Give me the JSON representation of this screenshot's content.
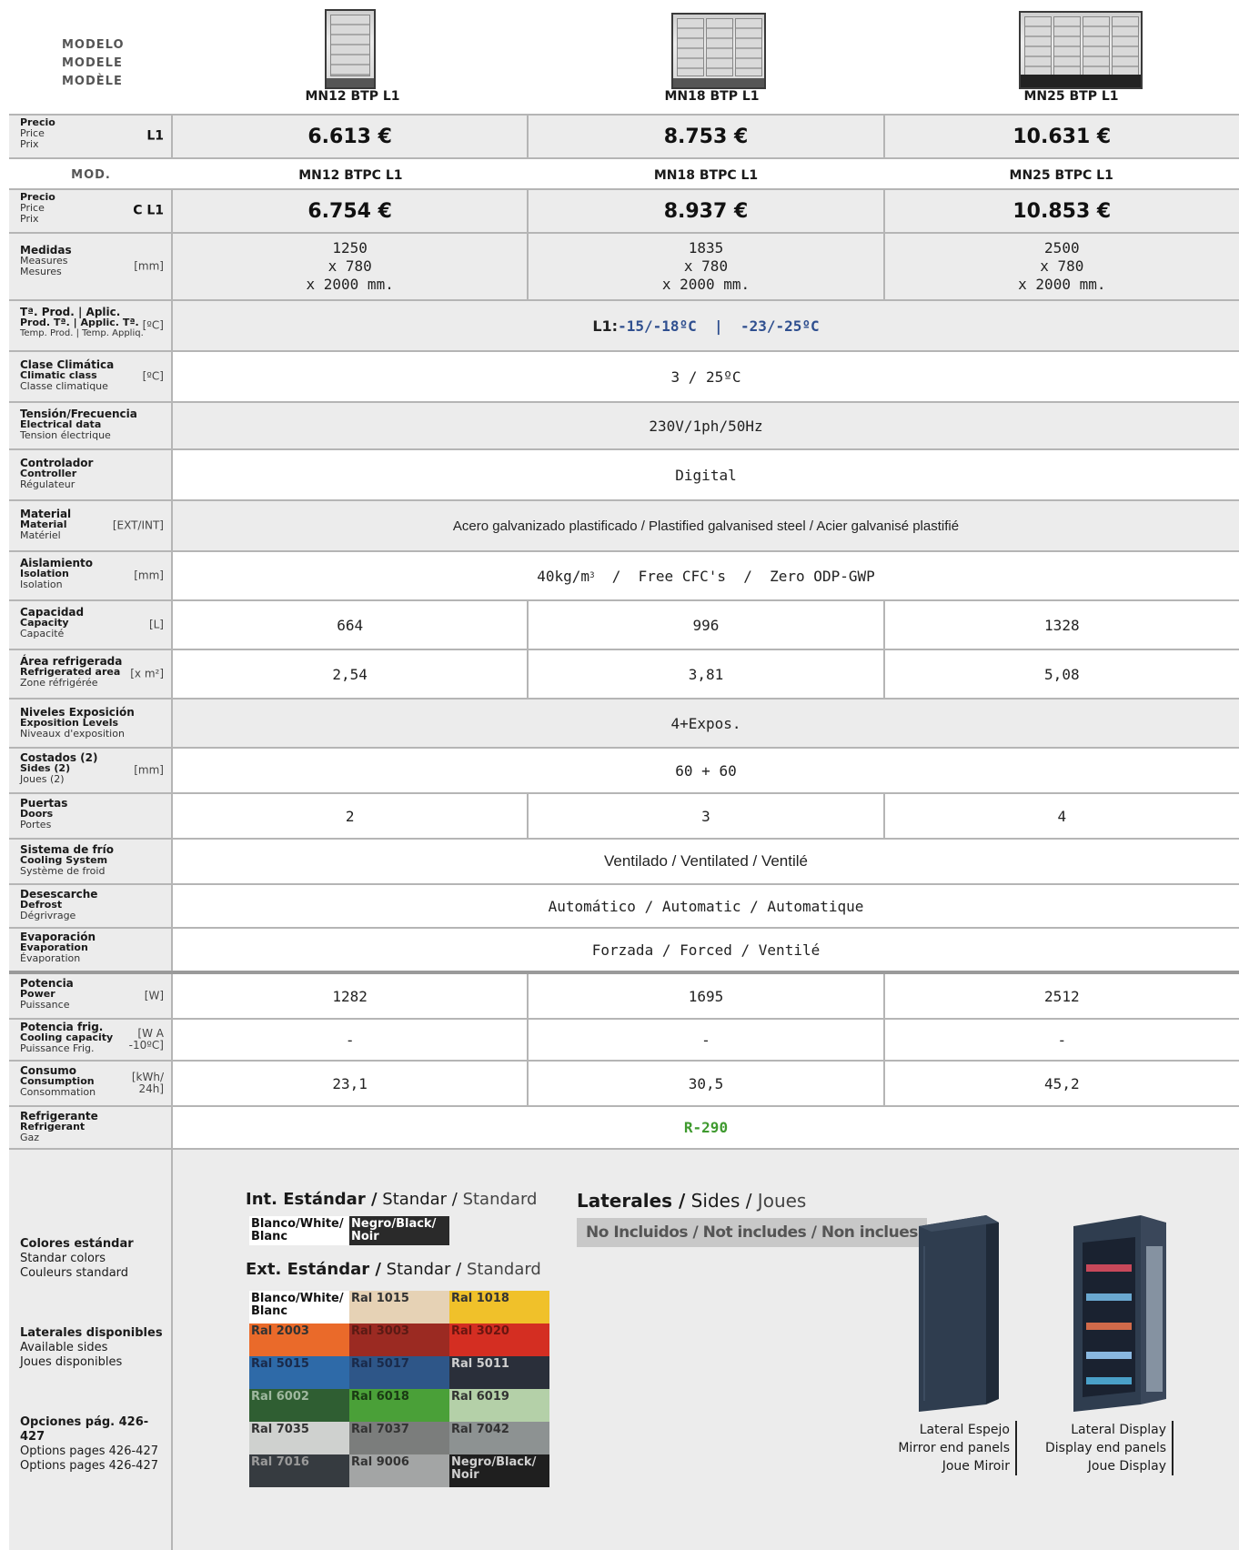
{
  "header": {
    "model_labels": [
      "MODELO",
      "MODELE",
      "MODÈLE"
    ],
    "models": [
      "MN12 BTP L1",
      "MN18 BTP L1",
      "MN25 BTP L1"
    ]
  },
  "price_l1": {
    "label": [
      "Precio",
      "Price",
      "Prix"
    ],
    "unit": "L1",
    "values": [
      "6.613 €",
      "8.753 €",
      "10.631 €"
    ]
  },
  "mod_row": {
    "label": "MOD.",
    "models": [
      "MN12 BTPC L1",
      "MN18 BTPC L1",
      "MN25 BTPC L1"
    ]
  },
  "price_cl1": {
    "label": [
      "Precio",
      "Price",
      "Prix"
    ],
    "unit": "C L1",
    "values": [
      "6.754 €",
      "8.937 €",
      "10.853 €"
    ]
  },
  "measures": {
    "label": [
      "Medidas",
      "Measures",
      "Mesures"
    ],
    "unit": "[mm]",
    "values": [
      [
        "1250",
        "x 780",
        "x 2000 mm."
      ],
      [
        "1835",
        "x 780",
        "x 2000 mm."
      ],
      [
        "2500",
        "x 780",
        "x 2000 mm."
      ]
    ]
  },
  "temp": {
    "label": [
      "Tª. Prod. | Aplic.",
      "Prod. Tª. | Applic. Tª.",
      "Temp. Prod. | Temp. Appliq."
    ],
    "unit": "[ºC]",
    "prefix": "L1: ",
    "value": "-15/-18ºC  |  -23/-25ºC"
  },
  "climate": {
    "label": [
      "Clase Climática",
      "Climatic class",
      "Classe climatique"
    ],
    "unit": "[ºC]",
    "value": "3 / 25ºC"
  },
  "tension": {
    "label": [
      "Tensión/Frecuencia",
      "Electrical data",
      "Tension électrique"
    ],
    "value": "230V/1ph/50Hz"
  },
  "controller": {
    "label": [
      "Controlador",
      "Controller",
      "Régulateur"
    ],
    "value": "Digital"
  },
  "material": {
    "label": [
      "Material",
      "Material",
      "Matériel"
    ],
    "unit": "[EXT/INT]",
    "value": "Acero galvanizado plastificado / Plastified galvanised steel / Acier galvanisé plastifié"
  },
  "insulation": {
    "label": [
      "Aislamiento",
      "Isolation",
      "Isolation"
    ],
    "unit": "[mm]",
    "value_a": "40kg/m",
    "sup": "3",
    "value_b": "  /  Free CFC's  /  Zero ODP-GWP"
  },
  "capacity": {
    "label": [
      "Capacidad",
      "Capacity",
      "Capacité"
    ],
    "unit": "[L]",
    "values": [
      "664",
      "996",
      "1328"
    ]
  },
  "area": {
    "label": [
      "Área refrigerada",
      "Refrigerated area",
      "Zone réfrigérée"
    ],
    "unit": "[x m²]",
    "values": [
      "2,54",
      "3,81",
      "5,08"
    ]
  },
  "levels": {
    "label": [
      "Niveles Exposición",
      "Exposition Levels",
      "Niveaux d'exposition"
    ],
    "value": "4+Expos."
  },
  "sides": {
    "label": [
      "Costados (2)",
      "Sides (2)",
      "Joues (2)"
    ],
    "unit": "[mm]",
    "value": "60 + 60"
  },
  "doors": {
    "label": [
      "Puertas",
      "Doors",
      "Portes"
    ],
    "values": [
      "2",
      "3",
      "4"
    ]
  },
  "cooling": {
    "label": [
      "Sistema de frío",
      "Cooling System",
      "Système de froid"
    ],
    "value": "Ventilado / Ventilated / Ventilé"
  },
  "defrost": {
    "label": [
      "Desescarche",
      "Defrost",
      "Dégrivrage"
    ],
    "value": "Automático / Automatic / Automatique"
  },
  "evap": {
    "label": [
      "Evaporación",
      "Evaporation",
      "Évaporation"
    ],
    "value": "Forzada / Forced / Ventilé"
  },
  "power": {
    "label": [
      "Potencia",
      "Power",
      "Puissance"
    ],
    "unit": "[W]",
    "values": [
      "1282",
      "1695",
      "2512"
    ]
  },
  "cooling_cap": {
    "label": [
      "Potencia frig.",
      "Cooling capacity",
      "Puissance Frig."
    ],
    "unit": [
      "[W A",
      "-10ºC]"
    ],
    "values": [
      "-",
      "-",
      "-"
    ]
  },
  "consumption": {
    "label": [
      "Consumo",
      "Consumption",
      "Consommation"
    ],
    "unit": [
      "[kWh/",
      "24h]"
    ],
    "values": [
      "23,1",
      "30,5",
      "45,2"
    ]
  },
  "refrigerant": {
    "label": [
      "Refrigerante",
      "Refrigerant",
      "Gaz"
    ],
    "value": "R-290"
  },
  "bottom": {
    "labels": [
      [
        "Colores estándar",
        "Standar colors",
        "Couleurs standard"
      ],
      [
        "Laterales disponibles",
        "Available sides",
        "Joues disponibles"
      ],
      [
        "Opciones pág. 426-427",
        "Options pages 426-427",
        "Options pages 426-427"
      ]
    ],
    "int_title": [
      "Int. Estándar /",
      " Standar /",
      " Standard"
    ],
    "int_swatches": [
      {
        "name": "Blanco/White/ Blanc",
        "bg": "#ffffff",
        "fg": "#111111"
      },
      {
        "name": "Negro/Black/ Noir",
        "bg": "#2a2a2a",
        "fg": "#ffffff"
      }
    ],
    "ext_title": [
      "Ext. Estándar /",
      " Standar /",
      " Standard"
    ],
    "ext_swatches": [
      {
        "name": "Blanco/White/ Blanc",
        "bg": "#ffffff",
        "fg": "#111111"
      },
      {
        "name": "Ral 1015",
        "bg": "#e6d2b5",
        "fg": "#333333"
      },
      {
        "name": "Ral 1018",
        "bg": "#f0c12a",
        "fg": "#333333"
      },
      {
        "name": "Ral 2003",
        "bg": "#ea6a2a",
        "fg": "#333333"
      },
      {
        "name": "Ral 3003",
        "bg": "#9b2a22",
        "fg": "#5a1a14"
      },
      {
        "name": "Ral 3020",
        "bg": "#d42e22",
        "fg": "#6a1510"
      },
      {
        "name": "Ral 5015",
        "bg": "#2e6aa8",
        "fg": "#1a2a4a"
      },
      {
        "name": "Ral 5017",
        "bg": "#2e5688",
        "fg": "#1a2a4a"
      },
      {
        "name": "Ral 5011",
        "bg": "#2a2f3a",
        "fg": "#cfcfcf"
      },
      {
        "name": "Ral 6002",
        "bg": "#2f5e32",
        "fg": "#9fb89f"
      },
      {
        "name": "Ral 6018",
        "bg": "#4aa038",
        "fg": "#1a3a14"
      },
      {
        "name": "Ral 6019",
        "bg": "#b4d0a8",
        "fg": "#333333"
      },
      {
        "name": "Ral 7035",
        "bg": "#cfd1cf",
        "fg": "#333333"
      },
      {
        "name": "Ral 7037",
        "bg": "#7b7d7c",
        "fg": "#333333"
      },
      {
        "name": "Ral 7042",
        "bg": "#8d9292",
        "fg": "#333333"
      },
      {
        "name": "Ral 7016",
        "bg": "#363b40",
        "fg": "#9a9a9a"
      },
      {
        "name": "Ral 9006",
        "bg": "#a3a5a5",
        "fg": "#333333"
      },
      {
        "name": "Negro/Black/ Noir",
        "bg": "#1f1f1f",
        "fg": "#d0d0d0"
      }
    ],
    "sides_title": [
      "Laterales /",
      " Sides /",
      " Joues"
    ],
    "not_included": "No Incluidos / Not includes / Non inclues",
    "mirror_caption": [
      "Lateral Espejo",
      "Mirror end panels",
      "Joue Miroir"
    ],
    "display_caption": [
      "Lateral Display",
      "Display end panels",
      "Joue Display"
    ]
  }
}
